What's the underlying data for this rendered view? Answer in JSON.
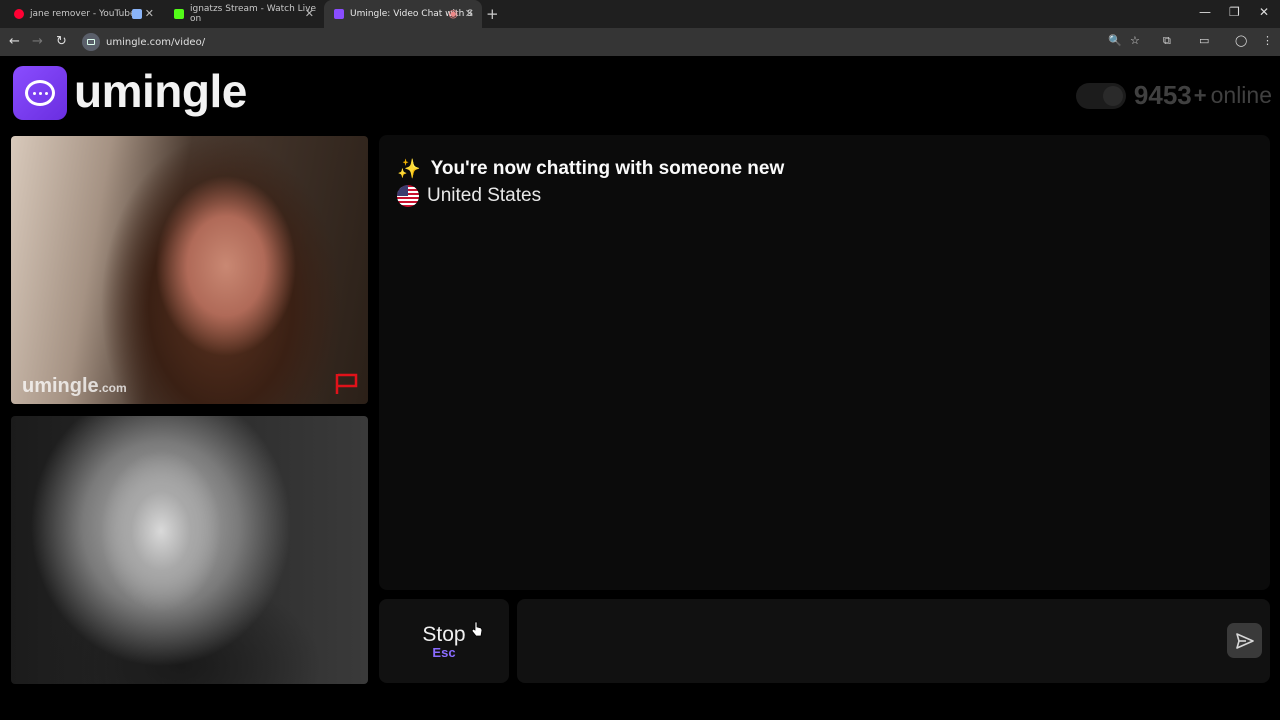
{
  "browser": {
    "tabs": [
      {
        "title": "jane remover - YouTube",
        "favicon_color": "#ff0033"
      },
      {
        "title": "",
        "favicon_color": "#8ab4f8"
      },
      {
        "title": "ignatzs Stream - Watch Live on",
        "favicon_color": "#53fc18"
      },
      {
        "title": "Umingle: Video Chat with S",
        "favicon_color": "#8a4dff"
      }
    ],
    "new_tab": "+",
    "url": "umingle.com/video/"
  },
  "header": {
    "logo_text": "umingle",
    "online_count": "9453",
    "online_plus": "+",
    "online_label": "online"
  },
  "remote_video": {
    "watermark_main": "umingle",
    "watermark_suffix": ".com"
  },
  "chat": {
    "status_message": "You're now chatting with someone new",
    "country": "United States"
  },
  "controls": {
    "stop_label": "Stop",
    "stop_key": "Esc",
    "message_placeholder": ""
  },
  "colors": {
    "accent": "#8a4dff",
    "chat_bg": "#0b0b0b",
    "report_flag": "#e0121a"
  }
}
